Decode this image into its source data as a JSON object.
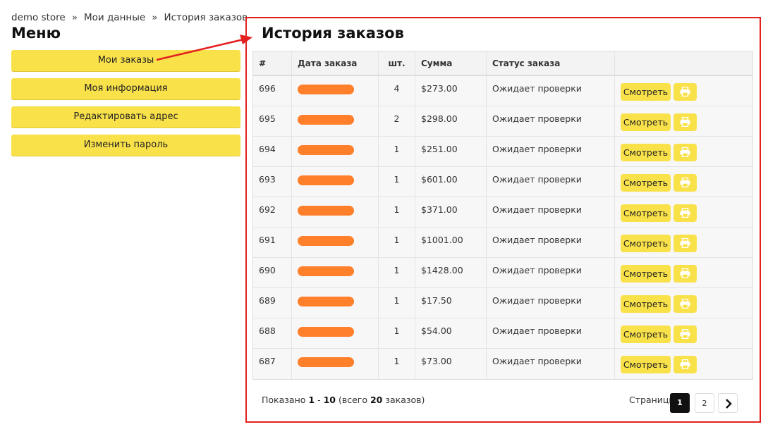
{
  "breadcrumb": {
    "items": [
      "demo store",
      "Мои данные",
      "История заказов"
    ],
    "separator": "»"
  },
  "menu": {
    "title": "Меню",
    "items": [
      "Мои заказы",
      "Моя информация",
      "Редактировать адрес",
      "Изменить пароль"
    ]
  },
  "page": {
    "title": "История заказов"
  },
  "table": {
    "headers": [
      "#",
      "Дата заказа",
      "шт.",
      "Сумма",
      "Статус заказа"
    ],
    "view_label": "Смотреть",
    "rows": [
      {
        "id": "696",
        "qty": "4",
        "sum": "$273.00",
        "status": "Ожидает проверки"
      },
      {
        "id": "695",
        "qty": "2",
        "sum": "$298.00",
        "status": "Ожидает проверки"
      },
      {
        "id": "694",
        "qty": "1",
        "sum": "$251.00",
        "status": "Ожидает проверки"
      },
      {
        "id": "693",
        "qty": "1",
        "sum": "$601.00",
        "status": "Ожидает проверки"
      },
      {
        "id": "692",
        "qty": "1",
        "sum": "$371.00",
        "status": "Ожидает проверки"
      },
      {
        "id": "691",
        "qty": "1",
        "sum": "$1001.00",
        "status": "Ожидает проверки"
      },
      {
        "id": "690",
        "qty": "1",
        "sum": "$1428.00",
        "status": "Ожидает проверки"
      },
      {
        "id": "689",
        "qty": "1",
        "sum": "$17.50",
        "status": "Ожидает проверки"
      },
      {
        "id": "688",
        "qty": "1",
        "sum": "$54.00",
        "status": "Ожидает проверки"
      },
      {
        "id": "687",
        "qty": "1",
        "sum": "$73.00",
        "status": "Ожидает проверки"
      }
    ]
  },
  "footer": {
    "shown_prefix": "Показано",
    "range_start": "1",
    "range_sep": "-",
    "range_end": "10",
    "total_prefix": "(всего",
    "total": "20",
    "total_suffix": "заказов)",
    "pages_label": "Страницы:",
    "pages": [
      "1",
      "2"
    ],
    "current_page": "1"
  },
  "colors": {
    "accent": "#f9e14a",
    "redaction": "#ff7f2a",
    "annotation": "#e32020"
  },
  "icons": {
    "print": "printer-icon",
    "next": "chevron-right-icon"
  }
}
